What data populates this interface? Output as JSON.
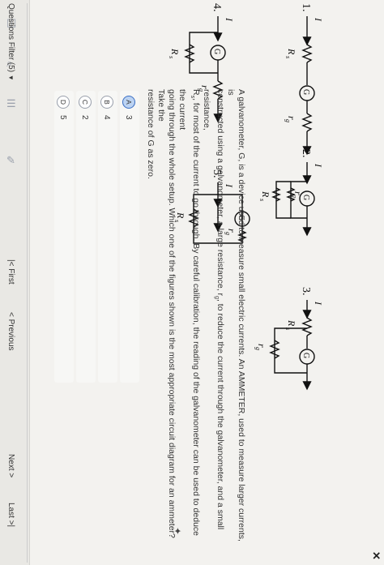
{
  "question": {
    "body_line1": "A galvanometer, G, is a device used to measure small electric currents. An AMMETER, used to measure larger currents, is",
    "body_line2": "constructed using a galvanometer, a large resistance, r",
    "body_line2b": ", to reduce the current through the galvanometer, and a small resistance,",
    "body_line3": "R",
    "body_line3b": ", for most of the current to go through. By careful calibration, the reading of the galvanometer can be used to deduce the current",
    "body_line4": "going through the whole setup. Which one of the figures shown is the most appropriate circuit diagram for an ammeter? Take the",
    "body_line5": "resistance of G as zero."
  },
  "figures": {
    "labels": [
      "1.",
      "2.",
      "3.",
      "4.",
      "5."
    ],
    "current": "I",
    "galvanometer": "G",
    "r_g": "r",
    "r_g_sub": "g",
    "R_s": "R",
    "R_s_sub": "s"
  },
  "options": [
    {
      "letter": "A",
      "value": "3",
      "selected": true
    },
    {
      "letter": "B",
      "value": "4",
      "selected": false
    },
    {
      "letter": "C",
      "value": "2",
      "selected": false
    },
    {
      "letter": "D",
      "value": "5",
      "selected": false
    }
  ],
  "footer": {
    "filter_label": "Questions Filter (5)",
    "first": "First",
    "previous": "Previous",
    "next": "Next",
    "last": "Last"
  },
  "icons": [
    "close-icon",
    "filter-dropdown-icon",
    "first-page-icon",
    "previous-icon",
    "next-icon",
    "last-page-icon",
    "report-flag-icon"
  ]
}
